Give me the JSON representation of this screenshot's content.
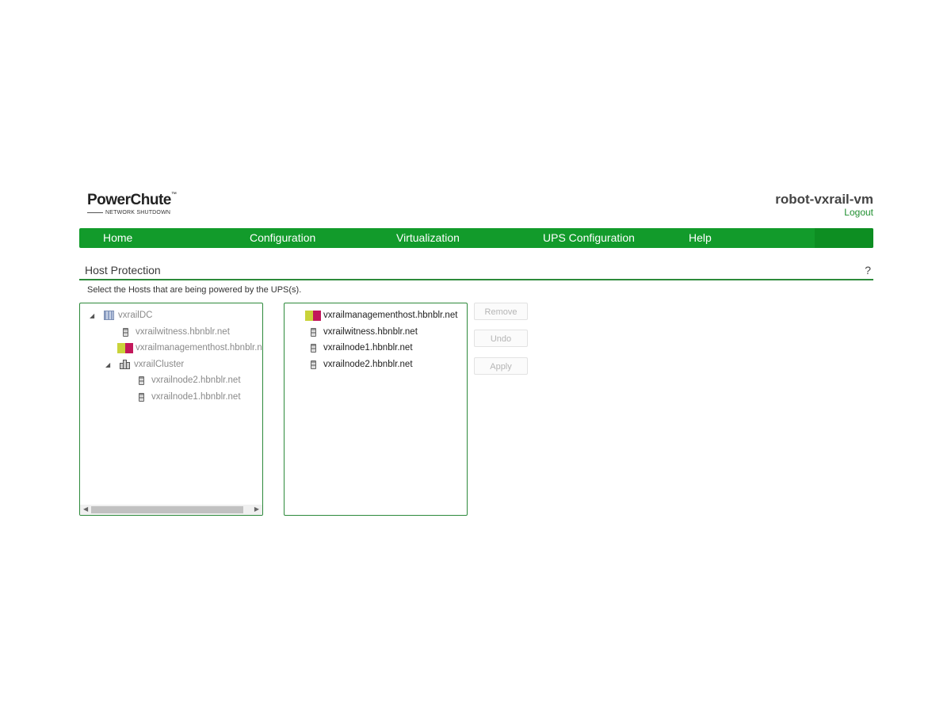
{
  "header": {
    "logo_main": "PowerChute",
    "logo_tm": "™",
    "logo_sub": "NETWORK SHUTDOWN",
    "hostname": "robot-vxrail-vm",
    "logout": "Logout"
  },
  "nav": {
    "items": [
      "Home",
      "Configuration",
      "Virtualization",
      "UPS Configuration",
      "Help"
    ]
  },
  "section": {
    "title": "Host Protection",
    "help": "?",
    "instruction": "Select the Hosts that are being powered by the UPS(s)."
  },
  "left_tree": {
    "expanded_glyph": "◢",
    "items": [
      {
        "label": "vxrailDC",
        "icon": "datacenter-icon"
      },
      {
        "label": "vxrailwitness.hbnblr.net",
        "icon": "server-icon"
      },
      {
        "label": "vxrailmanagementhost.hbnblr.net",
        "icon": "vm-host-icon"
      },
      {
        "label": "vxrailCluster",
        "icon": "cluster-icon"
      },
      {
        "label": "vxrailnode2.hbnblr.net",
        "icon": "server-icon"
      },
      {
        "label": "vxrailnode1.hbnblr.net",
        "icon": "server-icon"
      }
    ]
  },
  "right_list": {
    "items": [
      {
        "label": "vxrailmanagementhost.hbnblr.net",
        "icon": "vm-host-icon"
      },
      {
        "label": "vxrailwitness.hbnblr.net",
        "icon": "server-icon"
      },
      {
        "label": "vxrailnode1.hbnblr.net",
        "icon": "server-icon"
      },
      {
        "label": "vxrailnode2.hbnblr.net",
        "icon": "server-icon"
      }
    ]
  },
  "buttons": {
    "remove": "Remove",
    "undo": "Undo",
    "apply": "Apply"
  },
  "colors": {
    "nav_green": "#129b2b",
    "rule_green": "#2d8a3b",
    "link_green": "#1f8f2f"
  }
}
